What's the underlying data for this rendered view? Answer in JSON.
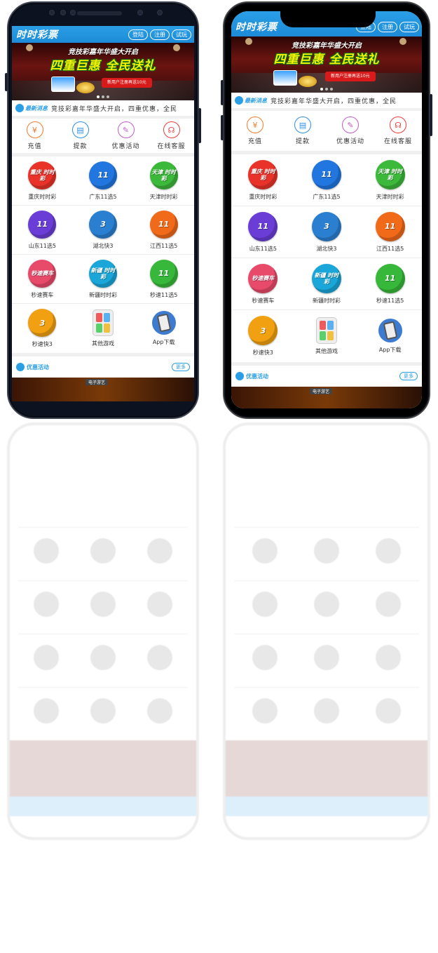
{
  "app": {
    "title": "时时彩票",
    "buttons": {
      "login": "登陆",
      "register": "注册",
      "trial": "试玩"
    }
  },
  "banner": {
    "headline": "竞技彩嘉年华盛大开启",
    "slogan": "四重巨惠 全民送礼",
    "promo": "新用户注册再送10元"
  },
  "notice": {
    "label": "最新消息",
    "text": "竞技彩嘉年华盛大开启，四重优惠，全民"
  },
  "quick_actions": [
    {
      "label": "充值",
      "icon": "yuan-icon",
      "color": "#f07a2a",
      "glyph": "¥"
    },
    {
      "label": "提款",
      "icon": "card-icon",
      "color": "#2a8fe6",
      "glyph": "▤"
    },
    {
      "label": "优惠活动",
      "icon": "tag-icon",
      "color": "#c05ac8",
      "glyph": "✎"
    },
    {
      "label": "在线客服",
      "icon": "headset-icon",
      "color": "#ee3a3a",
      "glyph": "☊"
    }
  ],
  "games": [
    {
      "label": "重庆时时彩",
      "badge": "重庆 时时彩",
      "color": "#e8322a"
    },
    {
      "label": "广东11选5",
      "badge": "11",
      "color": "#2276e0"
    },
    {
      "label": "天津时时彩",
      "badge": "天津 时时彩",
      "color": "#3cb83a"
    },
    {
      "label": "山东11选5",
      "badge": "11",
      "color": "#6a3dd6"
    },
    {
      "label": "湖北快3",
      "badge": "3",
      "color": "#2a7fd0"
    },
    {
      "label": "江西11选5",
      "badge": "11",
      "color": "#f06a1a"
    },
    {
      "label": "秒速赛车",
      "badge": "秒速赛车",
      "color": "#e84a6a"
    },
    {
      "label": "新疆时时彩",
      "badge": "新疆 时时彩",
      "color": "#1aa6d8"
    },
    {
      "label": "秒速11选5",
      "badge": "11",
      "color": "#38b83a"
    },
    {
      "label": "秒速快3",
      "badge": "3",
      "color": "#f0a010"
    },
    {
      "label": "其他游戏",
      "badge": "",
      "color": "#e8e8e8"
    },
    {
      "label": "App下载",
      "badge": "",
      "color": "#3c7bd0"
    }
  ],
  "activity": {
    "label": "优惠活动",
    "more": "更多",
    "banner_tag": "电子游艺"
  }
}
